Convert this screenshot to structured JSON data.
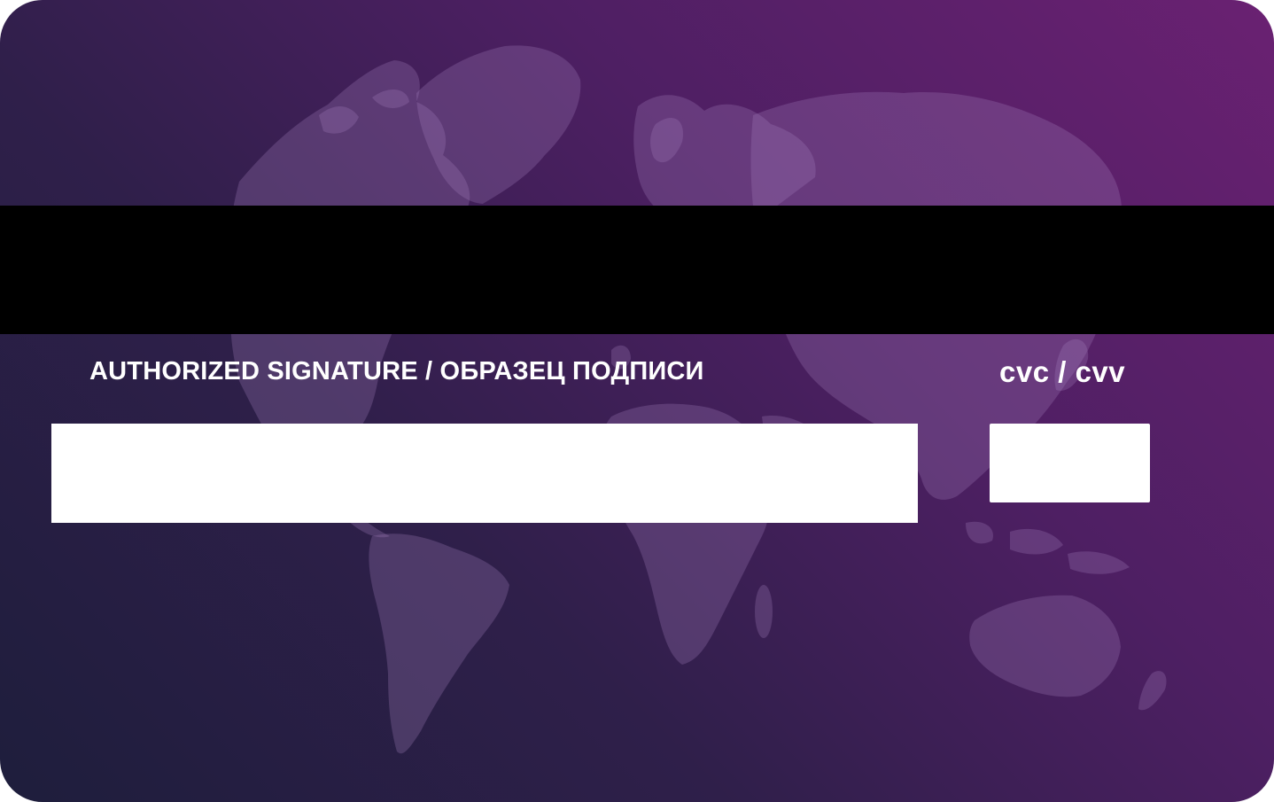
{
  "card": {
    "signature_label": "AUTHORIZED SIGNATURE / ОБРАЗЕЦ ПОДПИСИ",
    "cvc_label": "cvc / cvv",
    "signature_value": "",
    "cvc_value": ""
  },
  "colors": {
    "gradient_top_right": "#6a2172",
    "gradient_bottom_left": "#1e1e3c",
    "magnetic_stripe": "#000000",
    "signature_strip": "#ffffff",
    "cvc_box": "#ffffff",
    "label_text": "#ffffff"
  },
  "icons": {
    "background": "world-map-icon"
  }
}
